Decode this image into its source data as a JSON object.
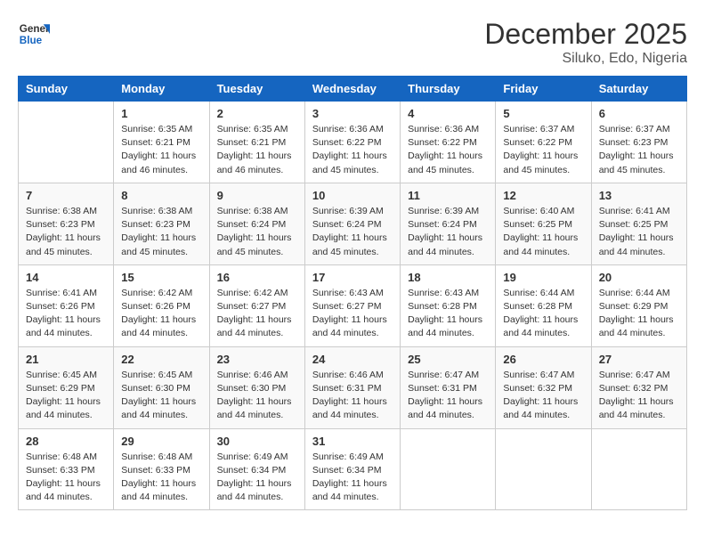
{
  "logo": {
    "general": "General",
    "blue": "Blue"
  },
  "title": "December 2025",
  "subtitle": "Siluko, Edo, Nigeria",
  "days_of_week": [
    "Sunday",
    "Monday",
    "Tuesday",
    "Wednesday",
    "Thursday",
    "Friday",
    "Saturday"
  ],
  "weeks": [
    [
      {
        "day": "",
        "info": ""
      },
      {
        "day": "1",
        "info": "Sunrise: 6:35 AM\nSunset: 6:21 PM\nDaylight: 11 hours and 46 minutes."
      },
      {
        "day": "2",
        "info": "Sunrise: 6:35 AM\nSunset: 6:21 PM\nDaylight: 11 hours and 46 minutes."
      },
      {
        "day": "3",
        "info": "Sunrise: 6:36 AM\nSunset: 6:22 PM\nDaylight: 11 hours and 45 minutes."
      },
      {
        "day": "4",
        "info": "Sunrise: 6:36 AM\nSunset: 6:22 PM\nDaylight: 11 hours and 45 minutes."
      },
      {
        "day": "5",
        "info": "Sunrise: 6:37 AM\nSunset: 6:22 PM\nDaylight: 11 hours and 45 minutes."
      },
      {
        "day": "6",
        "info": "Sunrise: 6:37 AM\nSunset: 6:23 PM\nDaylight: 11 hours and 45 minutes."
      }
    ],
    [
      {
        "day": "7",
        "info": "Sunrise: 6:38 AM\nSunset: 6:23 PM\nDaylight: 11 hours and 45 minutes."
      },
      {
        "day": "8",
        "info": "Sunrise: 6:38 AM\nSunset: 6:23 PM\nDaylight: 11 hours and 45 minutes."
      },
      {
        "day": "9",
        "info": "Sunrise: 6:38 AM\nSunset: 6:24 PM\nDaylight: 11 hours and 45 minutes."
      },
      {
        "day": "10",
        "info": "Sunrise: 6:39 AM\nSunset: 6:24 PM\nDaylight: 11 hours and 45 minutes."
      },
      {
        "day": "11",
        "info": "Sunrise: 6:39 AM\nSunset: 6:24 PM\nDaylight: 11 hours and 44 minutes."
      },
      {
        "day": "12",
        "info": "Sunrise: 6:40 AM\nSunset: 6:25 PM\nDaylight: 11 hours and 44 minutes."
      },
      {
        "day": "13",
        "info": "Sunrise: 6:41 AM\nSunset: 6:25 PM\nDaylight: 11 hours and 44 minutes."
      }
    ],
    [
      {
        "day": "14",
        "info": "Sunrise: 6:41 AM\nSunset: 6:26 PM\nDaylight: 11 hours and 44 minutes."
      },
      {
        "day": "15",
        "info": "Sunrise: 6:42 AM\nSunset: 6:26 PM\nDaylight: 11 hours and 44 minutes."
      },
      {
        "day": "16",
        "info": "Sunrise: 6:42 AM\nSunset: 6:27 PM\nDaylight: 11 hours and 44 minutes."
      },
      {
        "day": "17",
        "info": "Sunrise: 6:43 AM\nSunset: 6:27 PM\nDaylight: 11 hours and 44 minutes."
      },
      {
        "day": "18",
        "info": "Sunrise: 6:43 AM\nSunset: 6:28 PM\nDaylight: 11 hours and 44 minutes."
      },
      {
        "day": "19",
        "info": "Sunrise: 6:44 AM\nSunset: 6:28 PM\nDaylight: 11 hours and 44 minutes."
      },
      {
        "day": "20",
        "info": "Sunrise: 6:44 AM\nSunset: 6:29 PM\nDaylight: 11 hours and 44 minutes."
      }
    ],
    [
      {
        "day": "21",
        "info": "Sunrise: 6:45 AM\nSunset: 6:29 PM\nDaylight: 11 hours and 44 minutes."
      },
      {
        "day": "22",
        "info": "Sunrise: 6:45 AM\nSunset: 6:30 PM\nDaylight: 11 hours and 44 minutes."
      },
      {
        "day": "23",
        "info": "Sunrise: 6:46 AM\nSunset: 6:30 PM\nDaylight: 11 hours and 44 minutes."
      },
      {
        "day": "24",
        "info": "Sunrise: 6:46 AM\nSunset: 6:31 PM\nDaylight: 11 hours and 44 minutes."
      },
      {
        "day": "25",
        "info": "Sunrise: 6:47 AM\nSunset: 6:31 PM\nDaylight: 11 hours and 44 minutes."
      },
      {
        "day": "26",
        "info": "Sunrise: 6:47 AM\nSunset: 6:32 PM\nDaylight: 11 hours and 44 minutes."
      },
      {
        "day": "27",
        "info": "Sunrise: 6:47 AM\nSunset: 6:32 PM\nDaylight: 11 hours and 44 minutes."
      }
    ],
    [
      {
        "day": "28",
        "info": "Sunrise: 6:48 AM\nSunset: 6:33 PM\nDaylight: 11 hours and 44 minutes."
      },
      {
        "day": "29",
        "info": "Sunrise: 6:48 AM\nSunset: 6:33 PM\nDaylight: 11 hours and 44 minutes."
      },
      {
        "day": "30",
        "info": "Sunrise: 6:49 AM\nSunset: 6:34 PM\nDaylight: 11 hours and 44 minutes."
      },
      {
        "day": "31",
        "info": "Sunrise: 6:49 AM\nSunset: 6:34 PM\nDaylight: 11 hours and 44 minutes."
      },
      {
        "day": "",
        "info": ""
      },
      {
        "day": "",
        "info": ""
      },
      {
        "day": "",
        "info": ""
      }
    ]
  ]
}
